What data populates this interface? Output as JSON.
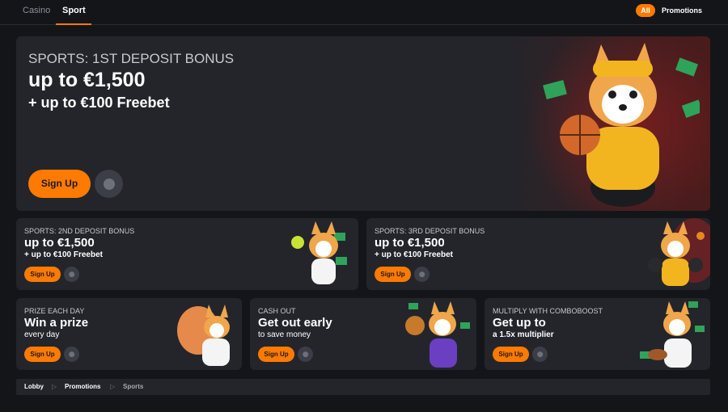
{
  "nav": {
    "tabs": [
      {
        "label": "Casino"
      },
      {
        "label": "Sport"
      }
    ],
    "filter_all": "All",
    "promotions_link": "Promotions"
  },
  "colors": {
    "accent": "#ff7a00",
    "card": "#23252b",
    "bg": "#141518"
  },
  "hero": {
    "eyebrow": "SPORTS: 1ST DEPOSIT BONUS",
    "headline": "up to €1,500",
    "subline": "+ up to €100 Freebet",
    "button": "Sign Up"
  },
  "cards": [
    {
      "eyebrow": "SPORTS: 2ND DEPOSIT BONUS",
      "headline": "up to €1,500",
      "subline": "+ up to €100 Freebet",
      "button": "Sign Up"
    },
    {
      "eyebrow": "SPORTS: 3RD DEPOSIT BONUS",
      "headline": "up to €1,500",
      "subline": "+ up to €100 Freebet",
      "button": "Sign Up"
    },
    {
      "eyebrow": "PRIZE EACH DAY",
      "headline": "Win a prize",
      "subline": "every day",
      "button": "Sign Up"
    },
    {
      "eyebrow": "CASH OUT",
      "headline": "Get out early",
      "subline": "to save money",
      "button": "Sign Up"
    },
    {
      "eyebrow": "MULTIPLY WITH COMBOBOOST",
      "headline": "Get up to",
      "subline": "a 1.5x multiplier",
      "button": "Sign Up"
    }
  ],
  "breadcrumb": {
    "items": [
      "Lobby",
      "Promotions",
      "Sports"
    ],
    "separator": "▷"
  }
}
